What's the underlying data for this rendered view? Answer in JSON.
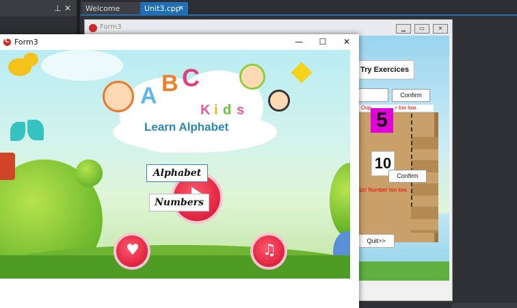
{
  "ide": {
    "tabs": [
      {
        "label": "Welcome Page"
      },
      {
        "label": "Unit3.cpp",
        "close": "✕"
      }
    ],
    "pin_icon": "pin-icon",
    "close_icon": "close-icon",
    "accent": "#1f6fb5"
  },
  "designer_form": {
    "title": "Form3",
    "buttons": {
      "try": "Try Exercices",
      "confirm1": "Confirm",
      "confirm2": "Confirm",
      "quit": "Quit>>"
    },
    "labels": {
      "oops1_left": "Oop",
      "oops1_right": "r too low.",
      "oops2": "ops! Number too low.",
      "number_five": "5",
      "number_ten": "10"
    }
  },
  "app_window": {
    "title": "Form3",
    "controls": {
      "minimize": "—",
      "maximize": "☐",
      "close": "✕"
    },
    "logo": {
      "letters": [
        "A",
        "B",
        "C"
      ],
      "kids": [
        "K",
        "i",
        "d",
        "s"
      ],
      "subtitle": "Learn Alphabet"
    },
    "buttons": {
      "alphabet": "Alphabet",
      "numbers": "Numbers"
    },
    "icons": {
      "heart": "heart-icon",
      "music": "music-note-icon"
    }
  }
}
